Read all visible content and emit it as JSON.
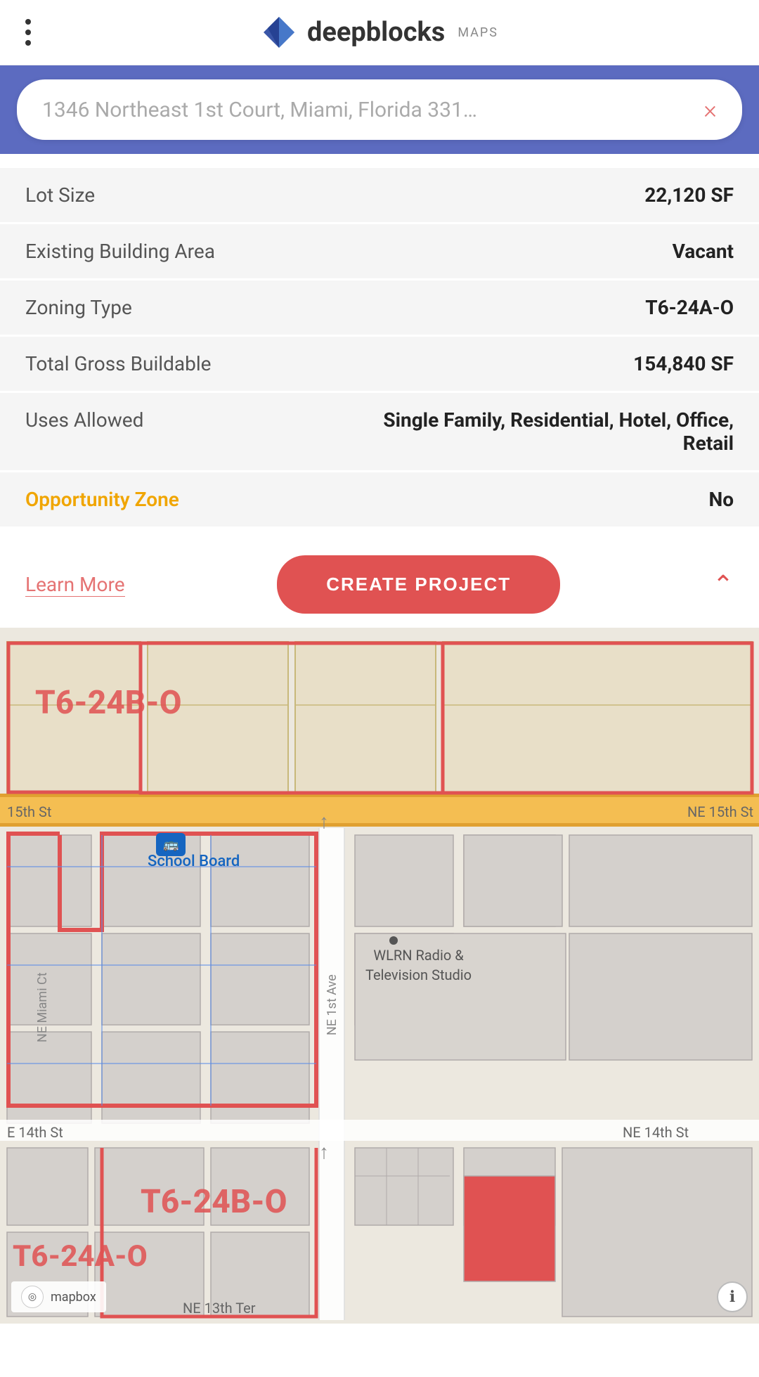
{
  "header": {
    "menu_label": "menu",
    "logo_text": "deepblocks",
    "logo_maps": "MAPS"
  },
  "search": {
    "address": "1346 Northeast 1st Court, Miami, Florida 331…",
    "clear_label": "×"
  },
  "property": {
    "rows": [
      {
        "label": "Lot Size",
        "value": "22,120 SF"
      },
      {
        "label": "Existing Building Area",
        "value": "Vacant"
      },
      {
        "label": "Zoning Type",
        "value": "T6-24A-O"
      },
      {
        "label": "Total Gross Buildable",
        "value": "154,840 SF"
      },
      {
        "label": "Uses Allowed",
        "value": "Single Family, Residential, Hotel, Office, Retail"
      },
      {
        "label": "Opportunity Zone",
        "value": "No",
        "highlight": true
      }
    ]
  },
  "actions": {
    "learn_more": "Learn More",
    "create_project": "CREATE PROJECT",
    "collapse_icon": "⌃"
  },
  "map": {
    "zones": [
      {
        "id": "zone1",
        "label": "T6-24B-O"
      },
      {
        "id": "zone2",
        "label": "T6-24B-O"
      },
      {
        "id": "zone3",
        "label": "T6-24A-O"
      }
    ],
    "streets": [
      "NE 15th St",
      "NE 14th St",
      "NE 13th Ter",
      "NE 14th",
      "NE Miami Ct",
      "NE 1st Ave"
    ],
    "labels": [
      "School Board",
      "WLRN Radio & Television Studio"
    ],
    "mapbox": "mapbox",
    "info_icon": "ℹ"
  }
}
